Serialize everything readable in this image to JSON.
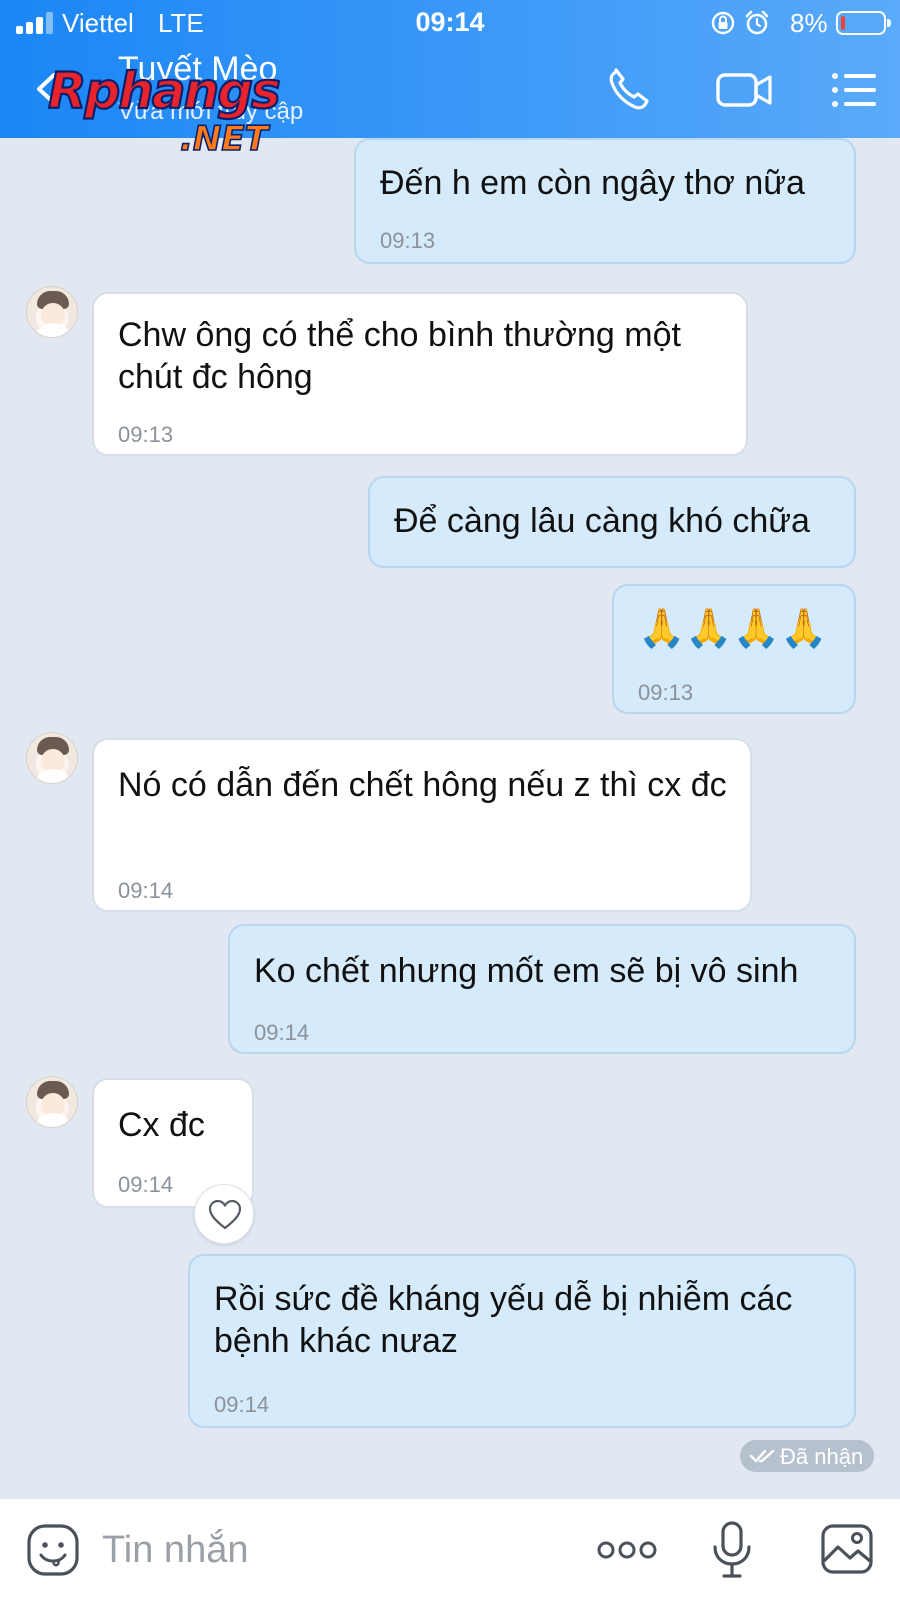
{
  "status_bar": {
    "carrier": "Viettel",
    "network": "LTE",
    "time": "09:14",
    "battery": "8%"
  },
  "header": {
    "contact_name": "Tuyết Mèo",
    "contact_status": "Vừa mới truy cập"
  },
  "watermark": {
    "brand": "Rphangs",
    "suffix": ".NET"
  },
  "messages": [
    {
      "direction": "sent",
      "text": "Đến h em còn  ngây thơ nữa",
      "time": "09:13"
    },
    {
      "direction": "received",
      "text": "Chw ông có thể cho bình thường một chút đc hông",
      "time": "09:13"
    },
    {
      "direction": "sent",
      "text": "Để càng lâu càng khó chữa",
      "time": ""
    },
    {
      "direction": "sent",
      "text": "🙏🙏🙏🙏",
      "time": "09:13"
    },
    {
      "direction": "received",
      "text": "Nó có dẫn đến chết hông nếu z thì cx đc",
      "time": "09:14"
    },
    {
      "direction": "sent",
      "text": "Ko chết nhưng mốt em sẽ bị vô sinh",
      "time": "09:14"
    },
    {
      "direction": "received",
      "text": "Cx đc",
      "time": "09:14"
    },
    {
      "direction": "sent",
      "text": "Rồi sức đề kháng yếu dễ bị nhiễm các bệnh khác nưaz",
      "time": "09:14"
    }
  ],
  "receipt": {
    "label": "Đã nhận"
  },
  "composer": {
    "placeholder": "Tin nhắn"
  },
  "colors": {
    "header": "#1b86f5",
    "sent_bubble": "#d5ebfb",
    "received_bubble": "#ffffff",
    "background": "#e1e8f1"
  }
}
